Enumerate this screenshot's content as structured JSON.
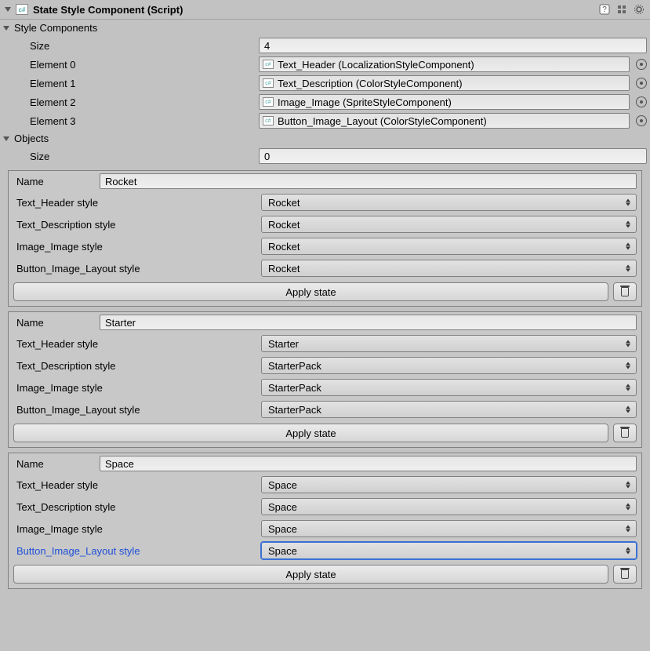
{
  "header": {
    "title": "State Style Component (Script)",
    "cs": "c#"
  },
  "styleComponents": {
    "label": "Style Components",
    "sizeLabel": "Size",
    "sizeValue": "4",
    "elements": [
      {
        "label": "Element 0",
        "value": "Text_Header (LocalizationStyleComponent)"
      },
      {
        "label": "Element 1",
        "value": "Text_Description (ColorStyleComponent)"
      },
      {
        "label": "Element 2",
        "value": "Image_Image (SpriteStyleComponent)"
      },
      {
        "label": "Element 3",
        "value": "Button_Image_Layout (ColorStyleComponent)"
      }
    ]
  },
  "objects": {
    "label": "Objects",
    "sizeLabel": "Size",
    "sizeValue": "0"
  },
  "states": [
    {
      "nameLabel": "Name",
      "nameValue": "Rocket",
      "rows": [
        {
          "label": "Text_Header style",
          "value": "Rocket"
        },
        {
          "label": "Text_Description style",
          "value": "Rocket"
        },
        {
          "label": "Image_Image style",
          "value": "Rocket"
        },
        {
          "label": "Button_Image_Layout style",
          "value": "Rocket"
        }
      ],
      "applyLabel": "Apply state"
    },
    {
      "nameLabel": "Name",
      "nameValue": "Starter",
      "rows": [
        {
          "label": "Text_Header style",
          "value": "Starter"
        },
        {
          "label": "Text_Description style",
          "value": "StarterPack"
        },
        {
          "label": "Image_Image style",
          "value": "StarterPack"
        },
        {
          "label": "Button_Image_Layout style",
          "value": "StarterPack"
        }
      ],
      "applyLabel": "Apply state"
    },
    {
      "nameLabel": "Name",
      "nameValue": "Space",
      "rows": [
        {
          "label": "Text_Header style",
          "value": "Space"
        },
        {
          "label": "Text_Description style",
          "value": "Space"
        },
        {
          "label": "Image_Image style",
          "value": "Space"
        },
        {
          "label": "Button_Image_Layout style",
          "value": "Space",
          "highlighted": true,
          "labelBlue": true
        }
      ],
      "applyLabel": "Apply state"
    }
  ]
}
